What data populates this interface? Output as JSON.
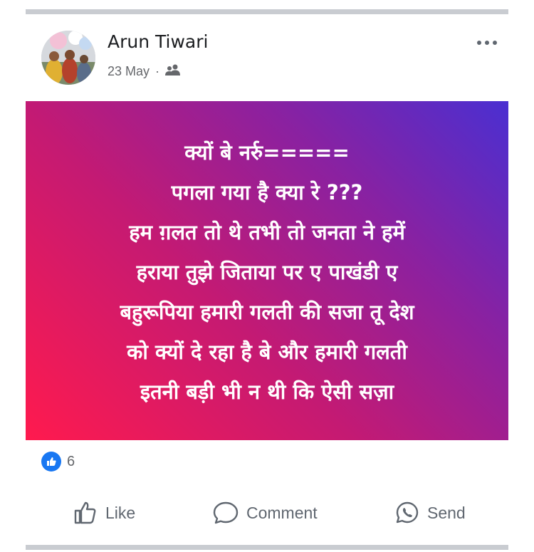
{
  "post": {
    "author": "Arun Tiwari",
    "date": "23 May",
    "separator": "·",
    "audience_icon": "friends-icon",
    "text": "क्यों बे नर्रु=====\nपगला गया है क्या रे ???\nहम ग़लत तो थे तभी तो जनता ने हमें\nहराया तुझे जिताया पर ए पाखंडी ए\nबहुरूपिया हमारी गलती की सजा तू देश\nको क्यों दे रहा है बे और हमारी गलती\nइतनी बड़ी भी न थी कि ऐसी सज़ा",
    "background": {
      "from": "#ff1a4e",
      "to": "#4a2fd1"
    }
  },
  "reactions": {
    "icon": "like-icon",
    "count": "6"
  },
  "actions": {
    "like": "Like",
    "comment": "Comment",
    "send": "Send"
  },
  "colors": {
    "accent": "#1877f2",
    "text_muted": "#65676b"
  }
}
